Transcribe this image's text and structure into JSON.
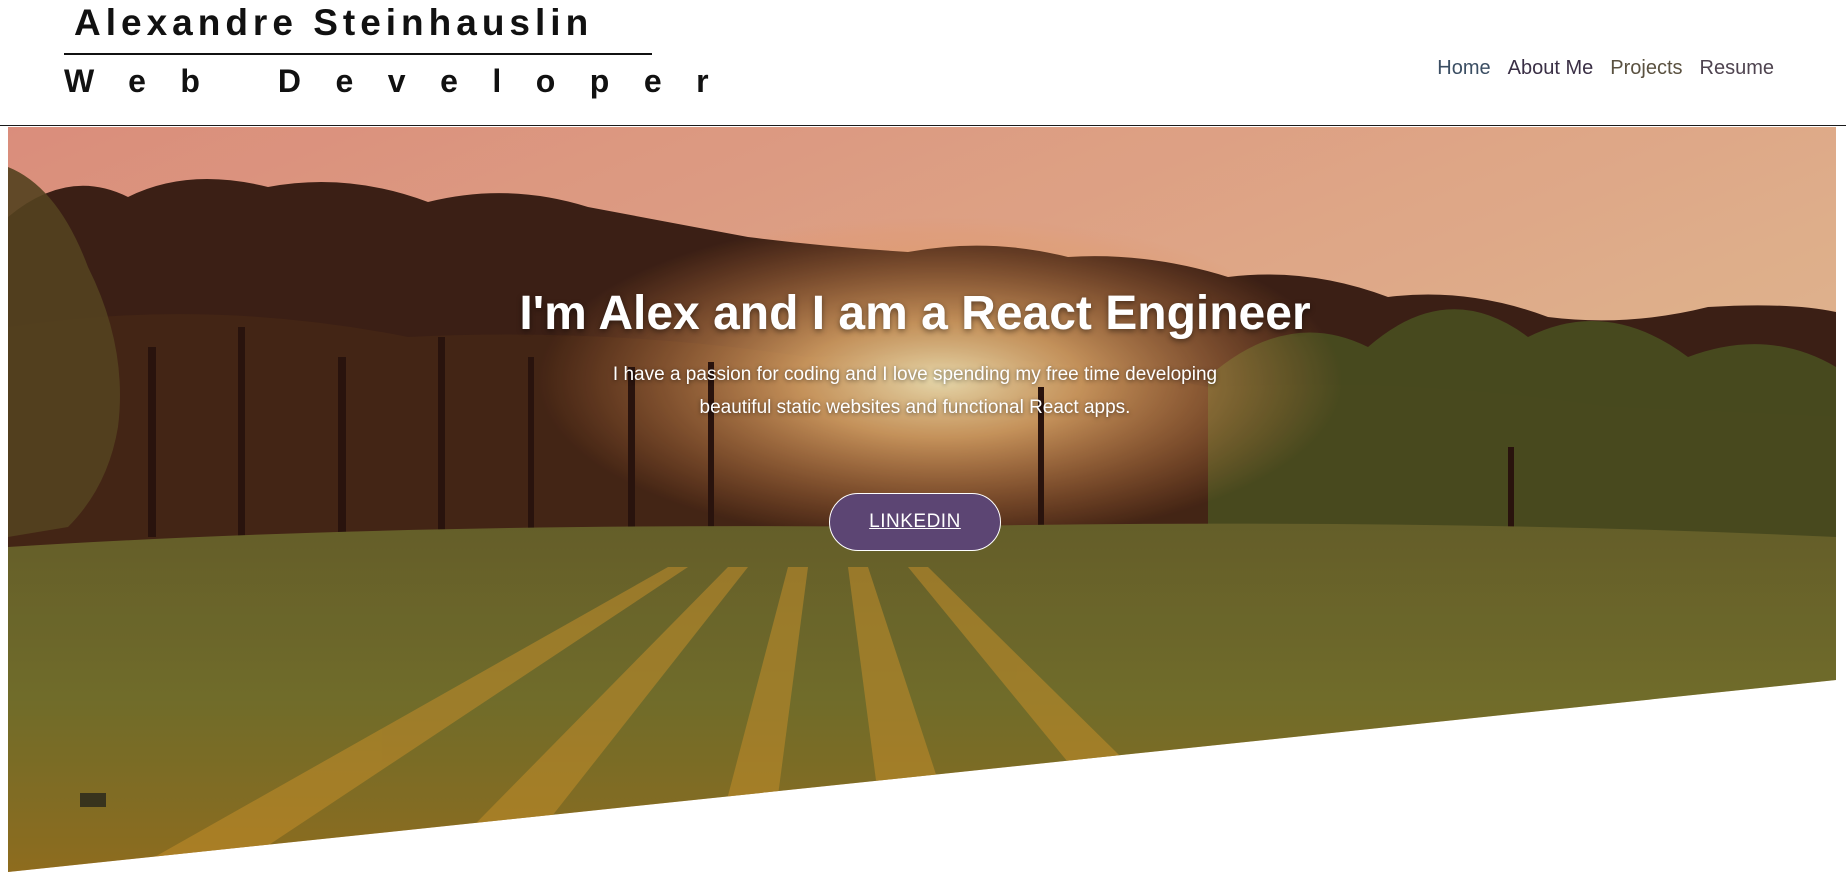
{
  "brand": {
    "name": "Alexandre Steinhauslin",
    "role": "Web Developer"
  },
  "nav": {
    "items": [
      {
        "label": "Home"
      },
      {
        "label": "About Me"
      },
      {
        "label": "Projects"
      },
      {
        "label": "Resume"
      }
    ]
  },
  "hero": {
    "title": "I'm Alex and I am a React Engineer",
    "subtitle_line1": "I have a passion for coding and I love spending my free time developing",
    "subtitle_line2": "beautiful static websites and functional React apps.",
    "button_label": "LINKEDIN",
    "image": "sunset-park-with-pine-trees"
  },
  "colors": {
    "button_bg": "#5c4573",
    "header_text": "#111111"
  }
}
